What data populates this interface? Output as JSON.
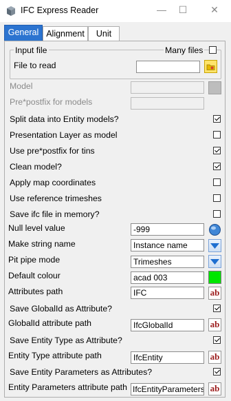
{
  "window": {
    "title": "IFC Express Reader",
    "minimize_glyph": "—",
    "maximize_glyph": "☐",
    "close_glyph": "✕"
  },
  "tabs": [
    {
      "label": "General",
      "active": true
    },
    {
      "label": "Alignment",
      "active": false
    },
    {
      "label": "Unit",
      "active": false
    }
  ],
  "input_file": {
    "group_label": "Input file",
    "many_files_label": "Many files",
    "many_files_checked": false,
    "file_to_read_label": "File to read",
    "file_to_read_value": "",
    "browse_icon": "folder-icon"
  },
  "model": {
    "label": "Model",
    "value": "",
    "enabled": false
  },
  "prepostfix": {
    "label": "Pre*postfix for models",
    "value": "",
    "enabled": false
  },
  "options": [
    {
      "label": "Split data into Entity models?",
      "checked": true
    },
    {
      "label": "Presentation Layer as model",
      "checked": false
    },
    {
      "label": "Use pre*postfix for tins",
      "checked": true
    },
    {
      "label": "Clean model?",
      "checked": true
    },
    {
      "label": "Apply map coordinates",
      "checked": false
    },
    {
      "label": "Use reference trimeshes",
      "checked": false
    },
    {
      "label": "Save ifc file in memory?",
      "checked": false
    }
  ],
  "null_level": {
    "label": "Null level value",
    "value": "-999"
  },
  "make_string_name": {
    "label": "Make string name",
    "value": "Instance name"
  },
  "pit_pipe_mode": {
    "label": "Pit pipe mode",
    "value": "Trimeshes"
  },
  "default_colour": {
    "label": "Default colour",
    "value": "acad 003",
    "swatch": "#00e600"
  },
  "attributes_path": {
    "label": "Attributes path",
    "value": "IFC"
  },
  "save_globalid": {
    "label": "Save GlobalId as Attribute?",
    "checked": true
  },
  "globalid_path": {
    "label": "GlobalId attribute path",
    "value": "IfcGlobalId"
  },
  "save_entity_type": {
    "label": "Save Entity Type as Attribute?",
    "checked": true
  },
  "entity_type_path": {
    "label": "Entity Type attribute path",
    "value": "IfcEntity"
  },
  "save_entity_params": {
    "label": "Save Entity Parameters as Attributes?",
    "checked": true
  },
  "entity_params_path": {
    "label": "Entity Parameters attribute path",
    "value": "IfcEntityParameters"
  },
  "ab_button_text": "ab",
  "colors": {
    "tab_active": "#2c74d0",
    "ab_text": "#9c1c1c"
  }
}
